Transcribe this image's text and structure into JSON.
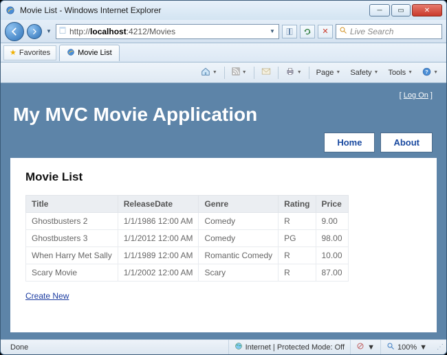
{
  "window": {
    "title": "Movie List - Windows Internet Explorer"
  },
  "address": {
    "prefix": "http://",
    "host": "localhost",
    "port_path": ":4212/Movies"
  },
  "search": {
    "placeholder": "Live Search"
  },
  "favorites": {
    "label": "Favorites"
  },
  "tab": {
    "label": "Movie List"
  },
  "commandbar": {
    "page": "Page",
    "safety": "Safety",
    "tools": "Tools"
  },
  "app": {
    "logon": "Log On",
    "title": "My MVC Movie Application",
    "nav": {
      "home": "Home",
      "about": "About"
    },
    "heading": "Movie List",
    "columns": {
      "title": "Title",
      "date": "ReleaseDate",
      "genre": "Genre",
      "rating": "Rating",
      "price": "Price"
    },
    "rows": [
      {
        "title": "Ghostbusters 2",
        "date": "1/1/1986 12:00 AM",
        "genre": "Comedy",
        "rating": "R",
        "price": "9.00"
      },
      {
        "title": "Ghostbusters 3",
        "date": "1/1/2012 12:00 AM",
        "genre": "Comedy",
        "rating": "PG",
        "price": "98.00"
      },
      {
        "title": "When Harry Met Sally",
        "date": "1/1/1989 12:00 AM",
        "genre": "Romantic Comedy",
        "rating": "R",
        "price": "10.00"
      },
      {
        "title": "Scary Movie",
        "date": "1/1/2002 12:00 AM",
        "genre": "Scary",
        "rating": "R",
        "price": "87.00"
      }
    ],
    "create": "Create New"
  },
  "status": {
    "done": "Done",
    "zone": "Internet | Protected Mode: Off",
    "zoom": "100%"
  }
}
